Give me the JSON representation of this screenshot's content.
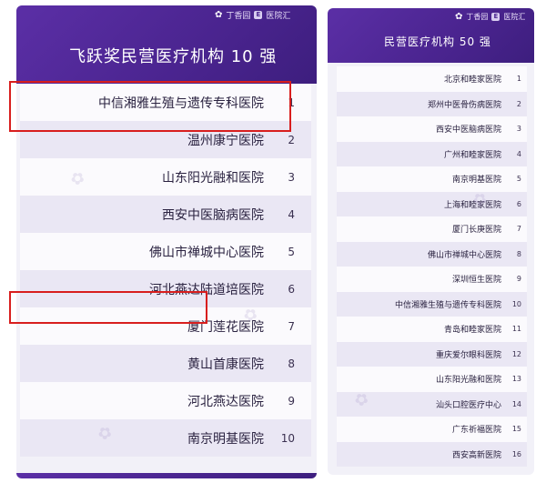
{
  "left": {
    "brand": {
      "name1": "丁香园",
      "name2": "医院汇"
    },
    "title": "飞跃奖民营医疗机构 10 强",
    "items": [
      {
        "rank": "1",
        "name": "中信湘雅生殖与遗传专科医院"
      },
      {
        "rank": "2",
        "name": "温州康宁医院"
      },
      {
        "rank": "3",
        "name": "山东阳光融和医院"
      },
      {
        "rank": "4",
        "name": "西安中医脑病医院"
      },
      {
        "rank": "5",
        "name": "佛山市禅城中心医院"
      },
      {
        "rank": "6",
        "name": "河北燕达陆道培医院"
      },
      {
        "rank": "7",
        "name": "厦门莲花医院"
      },
      {
        "rank": "8",
        "name": "黄山首康医院"
      },
      {
        "rank": "9",
        "name": "河北燕达医院"
      },
      {
        "rank": "10",
        "name": "南京明基医院"
      }
    ]
  },
  "right": {
    "brand": {
      "name1": "丁香园",
      "name2": "医院汇"
    },
    "title": "民营医疗机构 50 强",
    "items": [
      {
        "rank": "1",
        "name": "北京和睦家医院"
      },
      {
        "rank": "2",
        "name": "郑州中医骨伤病医院"
      },
      {
        "rank": "3",
        "name": "西安中医脑病医院"
      },
      {
        "rank": "4",
        "name": "广州和睦家医院"
      },
      {
        "rank": "5",
        "name": "南京明基医院"
      },
      {
        "rank": "6",
        "name": "上海和睦家医院"
      },
      {
        "rank": "7",
        "name": "厦门长庚医院"
      },
      {
        "rank": "8",
        "name": "佛山市禅城中心医院"
      },
      {
        "rank": "9",
        "name": "深圳恒生医院"
      },
      {
        "rank": "10",
        "name": "中信湘雅生殖与遗传专科医院"
      },
      {
        "rank": "11",
        "name": "青岛和睦家医院"
      },
      {
        "rank": "12",
        "name": "重庆爱尔眼科医院"
      },
      {
        "rank": "13",
        "name": "山东阳光融和医院"
      },
      {
        "rank": "14",
        "name": "汕头口腔医疗中心"
      },
      {
        "rank": "15",
        "name": "广东祈福医院"
      },
      {
        "rank": "16",
        "name": "西安高新医院"
      }
    ]
  }
}
